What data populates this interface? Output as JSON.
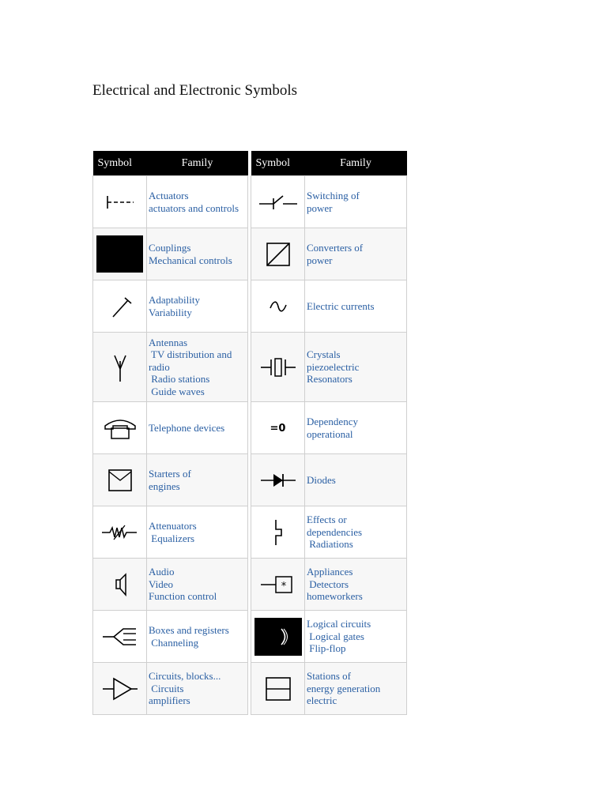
{
  "page": {
    "title": "Electrical and Electronic Symbols"
  },
  "headers": {
    "symbol": "Symbol",
    "family": "Family"
  },
  "left_rows": [
    {
      "icon": "actuator-icon",
      "lines": [
        "Actuators",
        "actuators and controls"
      ]
    },
    {
      "icon": "coupling-icon",
      "lines": [
        "Couplings",
        "Mechanical controls"
      ]
    },
    {
      "icon": "adaptability-icon",
      "lines": [
        "Adaptability",
        "Variability"
      ]
    },
    {
      "icon": "antenna-icon",
      "lines": [
        "Antennas",
        " TV distribution and",
        "radio",
        " Radio stations",
        " Guide waves"
      ]
    },
    {
      "icon": "telephone-icon",
      "lines": [
        "Telephone devices"
      ]
    },
    {
      "icon": "engine-starter-icon",
      "lines": [
        "Starters of",
        "engines"
      ]
    },
    {
      "icon": "attenuator-icon",
      "lines": [
        "Attenuators",
        " Equalizers"
      ]
    },
    {
      "icon": "speaker-icon",
      "lines": [
        "Audio",
        "Video",
        "Function control"
      ]
    },
    {
      "icon": "box-register-icon",
      "lines": [
        "Boxes and registers",
        " Channeling"
      ]
    },
    {
      "icon": "amplifier-icon",
      "lines": [
        "Circuits, blocks...",
        " Circuits",
        "amplifiers"
      ]
    }
  ],
  "right_rows": [
    {
      "icon": "power-switch-icon",
      "lines": [
        "Switching of",
        "power"
      ]
    },
    {
      "icon": "power-converter-icon",
      "lines": [
        "Converters of",
        "power"
      ]
    },
    {
      "icon": "alternating-current-icon",
      "lines": [
        "Electric currents"
      ]
    },
    {
      "icon": "crystal-icon",
      "lines": [
        "Crystals",
        "piezoelectric",
        "Resonators"
      ]
    },
    {
      "icon": "dependency-icon",
      "symbol_text": "=0",
      "lines": [
        "Dependency",
        "operational"
      ]
    },
    {
      "icon": "diode-icon",
      "lines": [
        "Diodes"
      ]
    },
    {
      "icon": "effect-icon",
      "lines": [
        "Effects or",
        "dependencies",
        " Radiations"
      ]
    },
    {
      "icon": "appliance-icon",
      "symbol_text": "*",
      "lines": [
        "Appliances",
        " Detectors",
        "homeworkers"
      ]
    },
    {
      "icon": "logic-circuit-icon",
      "lines": [
        "Logical circuits",
        " Logical gates",
        " Flip-flop"
      ]
    },
    {
      "icon": "generation-station-icon",
      "lines": [
        "Stations of",
        "energy generation",
        "electric"
      ]
    }
  ]
}
